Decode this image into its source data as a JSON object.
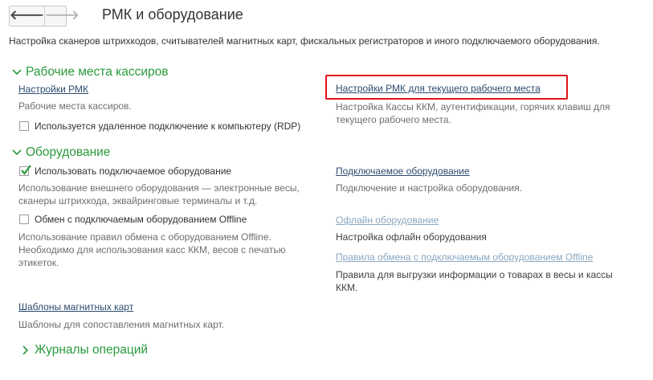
{
  "nav": {
    "back_icon": "arrow-left-icon",
    "forward_icon": "arrow-right-icon"
  },
  "page": {
    "title": "РМК и оборудование",
    "description": "Настройка сканеров штрихкодов, считывателей магнитных карт, фискальных регистраторов и иного подключаемого оборудования."
  },
  "sections": {
    "cashier": {
      "title": "Рабочие места кассиров",
      "rmk_link": "Настройки РМК",
      "rmk_hint": "Рабочие места кассиров.",
      "rdp_label": "Используется удаленное подключение к компьютеру (RDP)",
      "rdp_checked": false,
      "current_link": "Настройки РМК для текущего рабочего места",
      "current_hint_1": "Настройка Кассы ККМ, аутентификации, горячих клавиш для",
      "current_hint_2": "текущего рабочего места."
    },
    "equipment": {
      "title": "Оборудование",
      "use_label": "Использовать подключаемое оборудование",
      "use_checked": true,
      "use_hint_1": "Использование внешнего оборудования — электронные весы,",
      "use_hint_2": "сканеры штрихкода, эквайринговые терминалы и т.д.",
      "offline_label": "Обмен с подключаемым оборудованием Offline",
      "offline_checked": false,
      "offline_hint_1": "Использование правил обмена с оборудованием Offline.",
      "offline_hint_2": "Необходимо для использования касс ККМ, весов с печатью",
      "offline_hint_3": "этикеток.",
      "connected_link": "Подключаемое оборудование",
      "connected_hint": "Подключение и настройка оборудования.",
      "offline_link": "Офлайн оборудование",
      "offline_setup_text": "Настройка офлайн оборудования",
      "rules_link": "Правила обмена с подключаемым оборудованием Offline",
      "rules_hint_1": "Правила для выгрузки информации о товарах в весы и кассы",
      "rules_hint_2": "ККМ.",
      "cards_link": "Шаблоны магнитных карт",
      "cards_hint": "Шаблоны для сопоставления магнитных карт."
    },
    "journals": {
      "title": "Журналы операций"
    }
  },
  "colors": {
    "accent": "#2a9a3c",
    "link": "#2c4b6e",
    "highlight": "#e0141b"
  }
}
